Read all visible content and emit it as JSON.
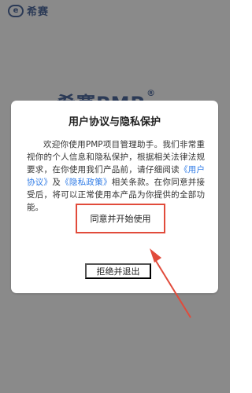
{
  "brand": {
    "logo_mark": "e",
    "name": "希赛"
  },
  "background": {
    "title_text": "希赛PMP",
    "title_sup": "®"
  },
  "dialog": {
    "title": "用户协议与隐私保护",
    "body_text_part1": "欢迎你使用PMP项目管理助手。我们非常重视你的个人信息和隐私保护，根据相关法律法规要求，在你使用我们产品前，请仔细阅读",
    "link_user_agreement": "《用户协议》",
    "body_text_and": "及",
    "link_privacy_policy": "《隐私政策》",
    "body_text_part2": "相关条款。在你同意并接受后，将可以正常使用本产品为你提供的全部功能。",
    "agree_button_label": "同意并开始使用",
    "reject_button_label": "拒绝并退出"
  },
  "colors": {
    "overlay": "#8a8a8a",
    "link": "#2f7be6",
    "annotation_red": "#e14b3b"
  }
}
